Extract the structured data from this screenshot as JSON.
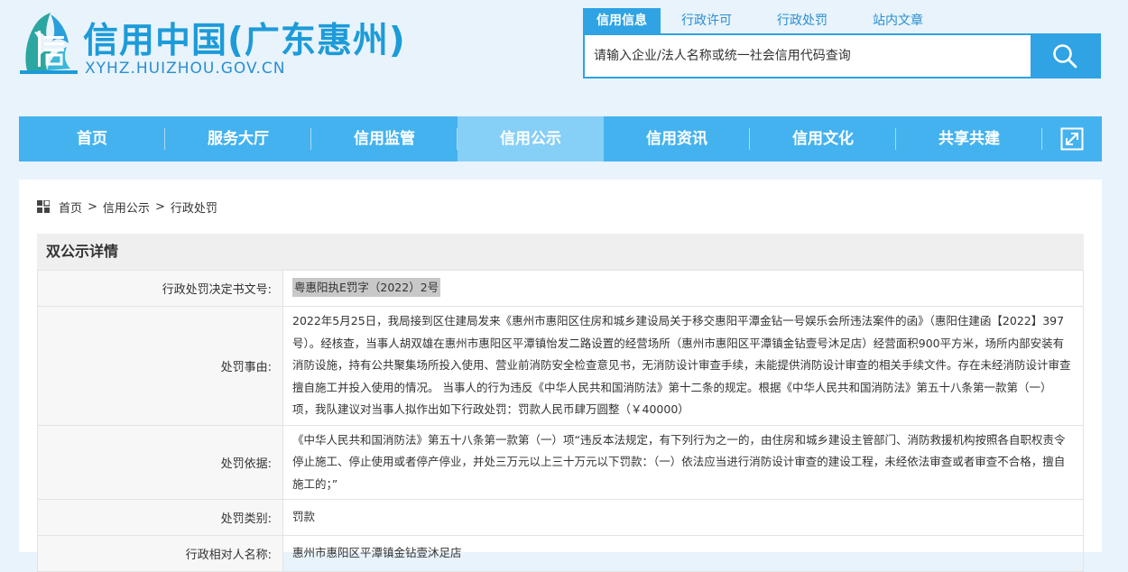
{
  "site": {
    "title": "信用中国(广东惠州)",
    "url": "XYHZ.HUIZHOU.GOV.CN",
    "logo_icon": "xin-seal-logo",
    "brand_color": "#1d9bd8"
  },
  "search": {
    "tabs": [
      "信用信息",
      "行政许可",
      "行政处罚",
      "站内文章"
    ],
    "active_tab": 0,
    "placeholder": "请输入企业/法人名称或统一社会信用代码查询",
    "value": "",
    "button_icon": "search-icon"
  },
  "nav": {
    "items": [
      "首页",
      "服务大厅",
      "信用监管",
      "信用公示",
      "信用资讯",
      "信用文化",
      "共享共建"
    ],
    "active_index": 3,
    "expand_icon": "expand-icon",
    "color": "#44b2ef",
    "active_color": "#86cff7"
  },
  "breadcrumb": {
    "icon": "grid-icon",
    "items": [
      "首页",
      "信用公示",
      "行政处罚"
    ],
    "separator": ">"
  },
  "detail": {
    "section_title": "双公示详情",
    "rows": [
      {
        "label": "行政处罚决定书文号:",
        "value": "粤惠阳执E罚字（2022）2号"
      },
      {
        "label": "处罚事由:",
        "value": "2022年5月25日，我局接到区住建局发来《惠州市惠阳区住房和城乡建设局关于移交惠阳平潭金钻一号娱乐会所违法案件的函》（惠阳住建函【2022】397号）。经核查，当事人胡双雄在惠州市惠阳区平潭镇怡发二路设置的经营场所（惠州市惠阳区平潭镇金钻壹号沐足店）经营面积900平方米，场所内部安装有消防设施，持有公共聚集场所投入使用、营业前消防安全检查意见书，无消防设计审查手续，未能提供消防设计审查的相关手续文件。存在未经消防设计审查擅自施工并投入使用的情况。  当事人的行为违反《中华人民共和国消防法》第十二条的规定。根据《中华人民共和国消防法》第五十八条第一款第（一）项，我队建议对当事人拟作出如下行政处罚：罚款人民币肆万圆整（￥40000）"
      },
      {
        "label": "处罚依据:",
        "value": "《中华人民共和国消防法》第五十八条第一款第（一）项“违反本法规定，有下列行为之一的，由住房和城乡建设主管部门、消防救援机构按照各自职权责令停止施工、停止使用或者停产停业，并处三万元以上三十万元以下罚款：（一）依法应当进行消防设计审查的建设工程，未经依法审查或者审查不合格，擅自施工的；”"
      },
      {
        "label": "处罚类别:",
        "value": "罚款"
      },
      {
        "label": "行政相对人名称:",
        "value": "惠州市惠阳区平潭镇金钻壹沐足店"
      }
    ]
  }
}
